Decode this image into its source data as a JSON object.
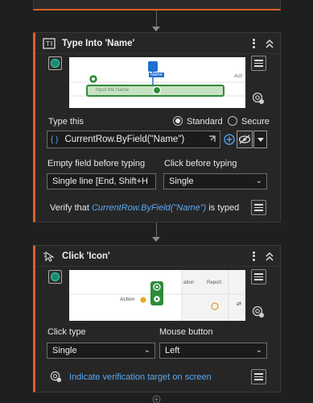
{
  "type_into": {
    "title": "Type Into 'Name'",
    "preview": {
      "name_tag": "Name",
      "col_header": "Acti",
      "input_placeholder": "Input the Name"
    },
    "type_this_label": "Type this",
    "radio_standard": "Standard",
    "radio_secure": "Secure",
    "expression_prefix": "{ }",
    "expression": "CurrentRow.ByField(\"Name\")",
    "empty_field_label": "Empty field before typing",
    "empty_field_value": "Single line [End, Shift+H",
    "click_before_label": "Click before typing",
    "click_before_value": "Single",
    "verify_prefix": "Verify that",
    "verify_expr": "CurrentRow.ByField(\"Name\")",
    "verify_suffix": "is typed"
  },
  "click_icon": {
    "title": "Click 'Icon'",
    "preview": {
      "col_action": "Action",
      "col_ation": "ation",
      "col_report": "Report"
    },
    "click_type_label": "Click type",
    "click_type_value": "Single",
    "mouse_button_label": "Mouse button",
    "mouse_button_value": "Left",
    "indicate_label": "Indicate verification target on screen"
  },
  "colors": {
    "accent": "#d8612a",
    "link": "#5aa9f2",
    "target_green": "#2e8b3a"
  }
}
